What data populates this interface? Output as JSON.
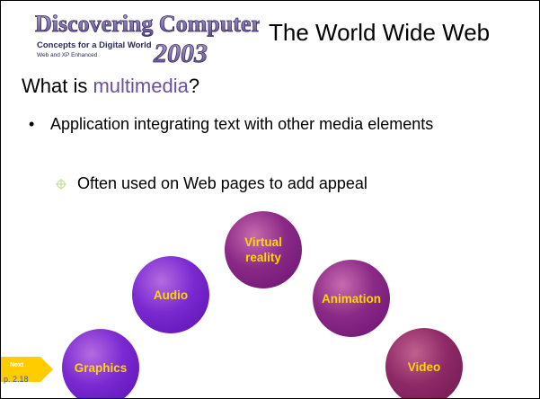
{
  "header": {
    "logo_title": "Discovering Computers",
    "logo_year": "2003",
    "logo_tagline": "Concepts for a Digital World",
    "logo_edition": "Web and XP Enhanced",
    "slide_title": "The World Wide Web"
  },
  "content": {
    "heading_prefix": "What is ",
    "heading_highlight": "multimedia",
    "heading_suffix": "?",
    "bullet_1": "Application integrating text with other media elements",
    "bullet_2": "Often used on Web pages to add appeal"
  },
  "bubbles": [
    {
      "label": "Graphics"
    },
    {
      "label": "Audio"
    },
    {
      "label": "Virtual reality"
    },
    {
      "label": "Animation"
    },
    {
      "label": "Video"
    }
  ],
  "footer": {
    "next_label": "Next",
    "page_ref": "p. 2.18"
  },
  "colors": {
    "highlight": "#6b4f9e",
    "bubble_text": "#ffd700",
    "next_arrow": "#ffcc00"
  }
}
